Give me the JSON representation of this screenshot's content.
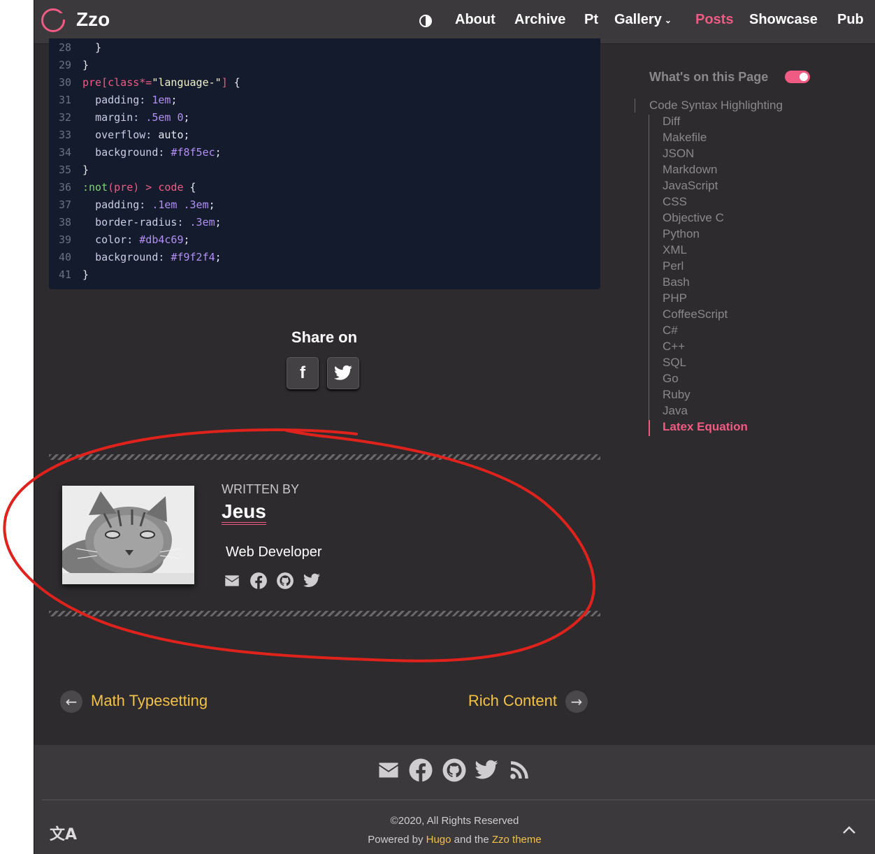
{
  "navbar": {
    "logo_text": "Zzo",
    "theme_toggle_icon": "contrast-icon",
    "items": [
      {
        "label": "About"
      },
      {
        "label": "Archive"
      },
      {
        "label": "Pt"
      },
      {
        "label": "Gallery"
      },
      {
        "label": "Posts"
      },
      {
        "label": "Showcase"
      },
      {
        "label": "Pub"
      }
    ],
    "active_item": "Posts",
    "accent_color": "#ef5b83"
  },
  "code": {
    "lines": [
      {
        "n": "28"
      },
      {
        "n": "29"
      },
      {
        "n": "30"
      },
      {
        "n": "31"
      },
      {
        "n": "32"
      },
      {
        "n": "33"
      },
      {
        "n": "34"
      },
      {
        "n": "35"
      },
      {
        "n": "36"
      },
      {
        "n": "37"
      },
      {
        "n": "38"
      },
      {
        "n": "39"
      },
      {
        "n": "40"
      },
      {
        "n": "41"
      }
    ],
    "tokens": {
      "brace_close": "}",
      "brace_open": "{",
      "selector_1": "pre[class*=",
      "selector_1_str": "\"language-\"",
      "selector_1_end": "]",
      "padding_prop": "padding:",
      "padding_val": "1em",
      "margin_prop": "margin:",
      "margin_val": ".5em 0",
      "overflow_prop": "overflow:",
      "overflow_val": "auto",
      "bg_prop": "background:",
      "bg_val_1": "#f8f5ec",
      "selector_2_a": ":not",
      "selector_2_b": "(pre) > code",
      "padding_val_2": ".1em .3em",
      "radius_prop": "border-radius:",
      "radius_val": ".3em",
      "color_prop": "color:",
      "color_val": "#db4c69",
      "bg_val_2": "#f9f2f4",
      "semi": ";"
    }
  },
  "share": {
    "title": "Share on",
    "buttons": [
      {
        "icon": "facebook-icon",
        "glyph": "f"
      },
      {
        "icon": "twitter-icon"
      }
    ]
  },
  "author": {
    "written_by": "WRITTEN BY",
    "name": "Jeus",
    "role": "Web Developer",
    "avatar": "cat-photo",
    "social_icons": [
      "email-icon",
      "facebook-icon",
      "github-icon",
      "twitter-icon"
    ]
  },
  "pagination": {
    "prev_label": "Math Typesetting",
    "next_label": "Rich Content",
    "prev_icon": "arrow-left-icon",
    "next_icon": "arrow-right-icon",
    "link_color": "#f3c146"
  },
  "toc": {
    "title": "What's on this Page",
    "root": "Code Syntax Highlighting",
    "items": [
      "Diff",
      "Makefile",
      "JSON",
      "Markdown",
      "JavaScript",
      "CSS",
      "Objective C",
      "Python",
      "XML",
      "Perl",
      "Bash",
      "PHP",
      "CoffeeScript",
      "C#",
      "C++",
      "SQL",
      "Go",
      "Ruby",
      "Java",
      "Latex Equation"
    ],
    "active_item": "Latex Equation"
  },
  "footer": {
    "icons": [
      "email-icon",
      "facebook-icon",
      "github-icon",
      "twitter-icon",
      "rss-icon"
    ],
    "copyright": "©2020, All Rights Reserved",
    "powered_prefix": "Powered by",
    "powered_hugo": "Hugo",
    "powered_middle": "and the",
    "powered_theme": "Zzo theme",
    "language_icon": "translate-icon",
    "lang_glyph": "文A",
    "scroll_top_icon": "chevron-up-icon"
  }
}
